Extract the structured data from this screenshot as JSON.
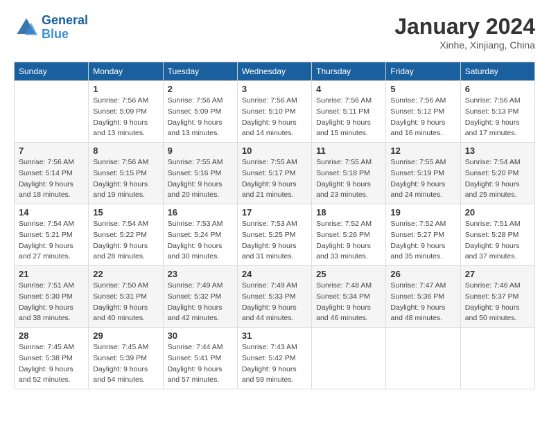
{
  "logo": {
    "line1": "General",
    "line2": "Blue"
  },
  "title": "January 2024",
  "location": "Xinhe, Xinjiang, China",
  "weekdays": [
    "Sunday",
    "Monday",
    "Tuesday",
    "Wednesday",
    "Thursday",
    "Friday",
    "Saturday"
  ],
  "weeks": [
    [
      {
        "day": "",
        "sunrise": "",
        "sunset": "",
        "daylight": ""
      },
      {
        "day": "1",
        "sunrise": "Sunrise: 7:56 AM",
        "sunset": "Sunset: 5:09 PM",
        "daylight": "Daylight: 9 hours and 13 minutes."
      },
      {
        "day": "2",
        "sunrise": "Sunrise: 7:56 AM",
        "sunset": "Sunset: 5:09 PM",
        "daylight": "Daylight: 9 hours and 13 minutes."
      },
      {
        "day": "3",
        "sunrise": "Sunrise: 7:56 AM",
        "sunset": "Sunset: 5:10 PM",
        "daylight": "Daylight: 9 hours and 14 minutes."
      },
      {
        "day": "4",
        "sunrise": "Sunrise: 7:56 AM",
        "sunset": "Sunset: 5:11 PM",
        "daylight": "Daylight: 9 hours and 15 minutes."
      },
      {
        "day": "5",
        "sunrise": "Sunrise: 7:56 AM",
        "sunset": "Sunset: 5:12 PM",
        "daylight": "Daylight: 9 hours and 16 minutes."
      },
      {
        "day": "6",
        "sunrise": "Sunrise: 7:56 AM",
        "sunset": "Sunset: 5:13 PM",
        "daylight": "Daylight: 9 hours and 17 minutes."
      }
    ],
    [
      {
        "day": "7",
        "sunrise": "Sunrise: 7:56 AM",
        "sunset": "Sunset: 5:14 PM",
        "daylight": "Daylight: 9 hours and 18 minutes."
      },
      {
        "day": "8",
        "sunrise": "Sunrise: 7:56 AM",
        "sunset": "Sunset: 5:15 PM",
        "daylight": "Daylight: 9 hours and 19 minutes."
      },
      {
        "day": "9",
        "sunrise": "Sunrise: 7:55 AM",
        "sunset": "Sunset: 5:16 PM",
        "daylight": "Daylight: 9 hours and 20 minutes."
      },
      {
        "day": "10",
        "sunrise": "Sunrise: 7:55 AM",
        "sunset": "Sunset: 5:17 PM",
        "daylight": "Daylight: 9 hours and 21 minutes."
      },
      {
        "day": "11",
        "sunrise": "Sunrise: 7:55 AM",
        "sunset": "Sunset: 5:18 PM",
        "daylight": "Daylight: 9 hours and 23 minutes."
      },
      {
        "day": "12",
        "sunrise": "Sunrise: 7:55 AM",
        "sunset": "Sunset: 5:19 PM",
        "daylight": "Daylight: 9 hours and 24 minutes."
      },
      {
        "day": "13",
        "sunrise": "Sunrise: 7:54 AM",
        "sunset": "Sunset: 5:20 PM",
        "daylight": "Daylight: 9 hours and 25 minutes."
      }
    ],
    [
      {
        "day": "14",
        "sunrise": "Sunrise: 7:54 AM",
        "sunset": "Sunset: 5:21 PM",
        "daylight": "Daylight: 9 hours and 27 minutes."
      },
      {
        "day": "15",
        "sunrise": "Sunrise: 7:54 AM",
        "sunset": "Sunset: 5:22 PM",
        "daylight": "Daylight: 9 hours and 28 minutes."
      },
      {
        "day": "16",
        "sunrise": "Sunrise: 7:53 AM",
        "sunset": "Sunset: 5:24 PM",
        "daylight": "Daylight: 9 hours and 30 minutes."
      },
      {
        "day": "17",
        "sunrise": "Sunrise: 7:53 AM",
        "sunset": "Sunset: 5:25 PM",
        "daylight": "Daylight: 9 hours and 31 minutes."
      },
      {
        "day": "18",
        "sunrise": "Sunrise: 7:52 AM",
        "sunset": "Sunset: 5:26 PM",
        "daylight": "Daylight: 9 hours and 33 minutes."
      },
      {
        "day": "19",
        "sunrise": "Sunrise: 7:52 AM",
        "sunset": "Sunset: 5:27 PM",
        "daylight": "Daylight: 9 hours and 35 minutes."
      },
      {
        "day": "20",
        "sunrise": "Sunrise: 7:51 AM",
        "sunset": "Sunset: 5:28 PM",
        "daylight": "Daylight: 9 hours and 37 minutes."
      }
    ],
    [
      {
        "day": "21",
        "sunrise": "Sunrise: 7:51 AM",
        "sunset": "Sunset: 5:30 PM",
        "daylight": "Daylight: 9 hours and 38 minutes."
      },
      {
        "day": "22",
        "sunrise": "Sunrise: 7:50 AM",
        "sunset": "Sunset: 5:31 PM",
        "daylight": "Daylight: 9 hours and 40 minutes."
      },
      {
        "day": "23",
        "sunrise": "Sunrise: 7:49 AM",
        "sunset": "Sunset: 5:32 PM",
        "daylight": "Daylight: 9 hours and 42 minutes."
      },
      {
        "day": "24",
        "sunrise": "Sunrise: 7:49 AM",
        "sunset": "Sunset: 5:33 PM",
        "daylight": "Daylight: 9 hours and 44 minutes."
      },
      {
        "day": "25",
        "sunrise": "Sunrise: 7:48 AM",
        "sunset": "Sunset: 5:34 PM",
        "daylight": "Daylight: 9 hours and 46 minutes."
      },
      {
        "day": "26",
        "sunrise": "Sunrise: 7:47 AM",
        "sunset": "Sunset: 5:36 PM",
        "daylight": "Daylight: 9 hours and 48 minutes."
      },
      {
        "day": "27",
        "sunrise": "Sunrise: 7:46 AM",
        "sunset": "Sunset: 5:37 PM",
        "daylight": "Daylight: 9 hours and 50 minutes."
      }
    ],
    [
      {
        "day": "28",
        "sunrise": "Sunrise: 7:45 AM",
        "sunset": "Sunset: 5:38 PM",
        "daylight": "Daylight: 9 hours and 52 minutes."
      },
      {
        "day": "29",
        "sunrise": "Sunrise: 7:45 AM",
        "sunset": "Sunset: 5:39 PM",
        "daylight": "Daylight: 9 hours and 54 minutes."
      },
      {
        "day": "30",
        "sunrise": "Sunrise: 7:44 AM",
        "sunset": "Sunset: 5:41 PM",
        "daylight": "Daylight: 9 hours and 57 minutes."
      },
      {
        "day": "31",
        "sunrise": "Sunrise: 7:43 AM",
        "sunset": "Sunset: 5:42 PM",
        "daylight": "Daylight: 9 hours and 59 minutes."
      },
      {
        "day": "",
        "sunrise": "",
        "sunset": "",
        "daylight": ""
      },
      {
        "day": "",
        "sunrise": "",
        "sunset": "",
        "daylight": ""
      },
      {
        "day": "",
        "sunrise": "",
        "sunset": "",
        "daylight": ""
      }
    ]
  ]
}
